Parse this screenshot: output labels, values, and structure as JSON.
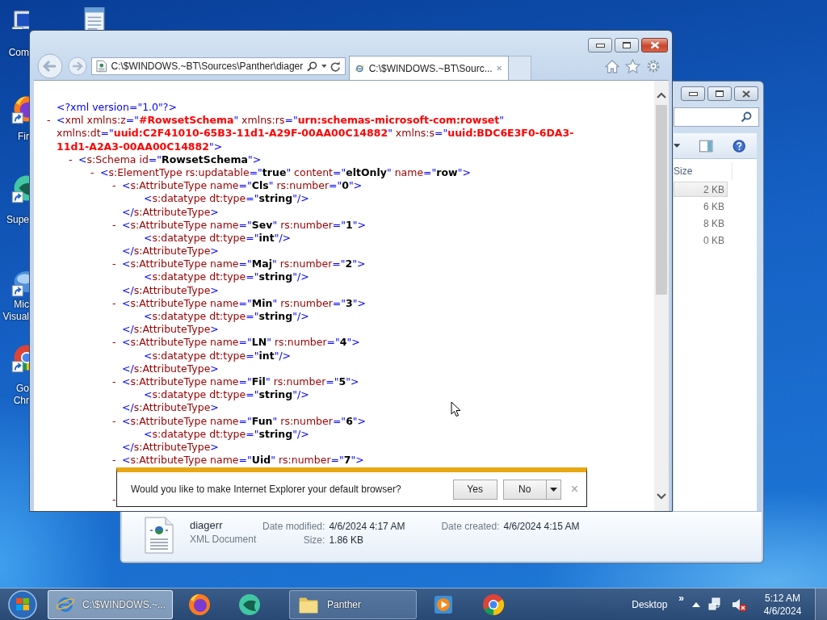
{
  "desktop_icons": [
    {
      "kind": "computer",
      "label": [
        "Com"
      ]
    },
    {
      "kind": "notepad"
    },
    {
      "kind": "firefox",
      "label": [
        "Fir"
      ]
    },
    {
      "kind": "app",
      "label": [
        "Supe"
      ]
    },
    {
      "kind": "vs",
      "label": [
        "Mic",
        "Visual"
      ]
    },
    {
      "kind": "chrome",
      "label": [
        "Go",
        "Chr"
      ]
    }
  ],
  "explorer": {
    "columns": [
      "Size"
    ],
    "rows": [
      {
        "size": "2 KB",
        "selected": true
      },
      {
        "size": "6 KB",
        "selected": false
      },
      {
        "size": "8 KB",
        "selected": false
      },
      {
        "size": "0 KB",
        "selected": false
      }
    ],
    "details": {
      "name": "diagerr",
      "type": "XML Document",
      "fields": [
        {
          "label": "Date modified:",
          "value": "4/6/2024 4:17 AM"
        },
        {
          "label": "Size:",
          "value": "1.86 KB"
        },
        {
          "label": "Date created:",
          "value": "4/6/2024 4:15 AM"
        }
      ]
    }
  },
  "browser": {
    "address": "C:\\$WINDOWS.~BT\\Sources\\Panther\\diager",
    "tabs": [
      {
        "title": "C:\\$WINDOWS.~BT\\Sourc...",
        "selected": true
      }
    ],
    "document": [
      {
        "open": [
          [
            {
              "kind": "p",
              "text": "<?xml version=\"1.0\"?>"
            }
          ]
        ]
      },
      {
        "marker": "-",
        "open": [
          [
            {
              "kind": "p",
              "text": "<"
            },
            {
              "kind": "n",
              "text": "xml"
            },
            {
              "kind": "n",
              "text": " xmlns:z"
            },
            {
              "kind": "p",
              "text": "=\""
            },
            {
              "kind": "r",
              "text": "#RowsetSchema"
            },
            {
              "kind": "p",
              "text": "\""
            },
            {
              "kind": "n",
              "text": " xmlns:rs"
            },
            {
              "kind": "p",
              "text": "=\""
            },
            {
              "kind": "r",
              "text": "urn:schemas-microsoft-com:rowset"
            },
            {
              "kind": "p",
              "text": "\""
            }
          ],
          [
            {
              "kind": "n",
              "text": "xmlns:dt"
            },
            {
              "kind": "p",
              "text": "=\""
            },
            {
              "kind": "r",
              "text": "uuid:C2F41010-65B3-11d1-A29F-00AA00C14882"
            },
            {
              "kind": "p",
              "text": "\""
            },
            {
              "kind": "n",
              "text": " xmlns:s"
            },
            {
              "kind": "p",
              "text": "=\""
            },
            {
              "kind": "r",
              "text": "uuid:BDC6E3F0-6DA3-"
            }
          ],
          [
            {
              "kind": "r",
              "text": "11d1-A2A3-00AA00C14882"
            },
            {
              "kind": "p",
              "text": "\">"
            }
          ]
        ],
        "children": [
          {
            "marker": "-",
            "open": [
              [
                {
                  "kind": "p",
                  "text": "<"
                },
                {
                  "kind": "n",
                  "text": "s:Schema"
                },
                {
                  "kind": "n",
                  "text": " id"
                },
                {
                  "kind": "p",
                  "text": "=\""
                },
                {
                  "kind": "v",
                  "text": "RowsetSchema"
                },
                {
                  "kind": "p",
                  "text": "\">"
                }
              ]
            ],
            "children": [
              {
                "marker": "-",
                "open": [
                  [
                    {
                      "kind": "p",
                      "text": "<"
                    },
                    {
                      "kind": "n",
                      "text": "s:ElementType"
                    },
                    {
                      "kind": "n",
                      "text": " rs:updatable"
                    },
                    {
                      "kind": "p",
                      "text": "=\""
                    },
                    {
                      "kind": "v",
                      "text": "true"
                    },
                    {
                      "kind": "p",
                      "text": "\""
                    },
                    {
                      "kind": "n",
                      "text": " content"
                    },
                    {
                      "kind": "p",
                      "text": "=\""
                    },
                    {
                      "kind": "v",
                      "text": "eltOnly"
                    },
                    {
                      "kind": "p",
                      "text": "\""
                    },
                    {
                      "kind": "n",
                      "text": " name"
                    },
                    {
                      "kind": "p",
                      "text": "=\""
                    },
                    {
                      "kind": "v",
                      "text": "row"
                    },
                    {
                      "kind": "p",
                      "text": "\">"
                    }
                  ]
                ],
                "children": [
                  {
                    "marker": "-",
                    "open": [
                      [
                        {
                          "kind": "p",
                          "text": "<"
                        },
                        {
                          "kind": "n",
                          "text": "s:AttributeType"
                        },
                        {
                          "kind": "n",
                          "text": " name"
                        },
                        {
                          "kind": "p",
                          "text": "=\""
                        },
                        {
                          "kind": "v",
                          "text": "Cls"
                        },
                        {
                          "kind": "p",
                          "text": "\""
                        },
                        {
                          "kind": "n",
                          "text": " rs:number"
                        },
                        {
                          "kind": "p",
                          "text": "=\""
                        },
                        {
                          "kind": "v",
                          "text": "0"
                        },
                        {
                          "kind": "p",
                          "text": "\">"
                        }
                      ]
                    ],
                    "children": [
                      {
                        "open": [
                          [
                            {
                              "kind": "p",
                              "text": "<"
                            },
                            {
                              "kind": "n",
                              "text": "s:datatype"
                            },
                            {
                              "kind": "n",
                              "text": " dt:type"
                            },
                            {
                              "kind": "p",
                              "text": "=\""
                            },
                            {
                              "kind": "v",
                              "text": "string"
                            },
                            {
                              "kind": "p",
                              "text": "\"/>"
                            }
                          ]
                        ]
                      }
                    ],
                    "close": [
                      {
                        "kind": "p",
                        "text": "</"
                      },
                      {
                        "kind": "n",
                        "text": "s:AttributeType"
                      },
                      {
                        "kind": "p",
                        "text": ">"
                      }
                    ]
                  },
                  {
                    "marker": "-",
                    "open": [
                      [
                        {
                          "kind": "p",
                          "text": "<"
                        },
                        {
                          "kind": "n",
                          "text": "s:AttributeType"
                        },
                        {
                          "kind": "n",
                          "text": " name"
                        },
                        {
                          "kind": "p",
                          "text": "=\""
                        },
                        {
                          "kind": "v",
                          "text": "Sev"
                        },
                        {
                          "kind": "p",
                          "text": "\""
                        },
                        {
                          "kind": "n",
                          "text": " rs:number"
                        },
                        {
                          "kind": "p",
                          "text": "=\""
                        },
                        {
                          "kind": "v",
                          "text": "1"
                        },
                        {
                          "kind": "p",
                          "text": "\">"
                        }
                      ]
                    ],
                    "children": [
                      {
                        "open": [
                          [
                            {
                              "kind": "p",
                              "text": "<"
                            },
                            {
                              "kind": "n",
                              "text": "s:datatype"
                            },
                            {
                              "kind": "n",
                              "text": " dt:type"
                            },
                            {
                              "kind": "p",
                              "text": "=\""
                            },
                            {
                              "kind": "v",
                              "text": "int"
                            },
                            {
                              "kind": "p",
                              "text": "\"/>"
                            }
                          ]
                        ]
                      }
                    ],
                    "close": [
                      {
                        "kind": "p",
                        "text": "</"
                      },
                      {
                        "kind": "n",
                        "text": "s:AttributeType"
                      },
                      {
                        "kind": "p",
                        "text": ">"
                      }
                    ]
                  },
                  {
                    "marker": "-",
                    "open": [
                      [
                        {
                          "kind": "p",
                          "text": "<"
                        },
                        {
                          "kind": "n",
                          "text": "s:AttributeType"
                        },
                        {
                          "kind": "n",
                          "text": " name"
                        },
                        {
                          "kind": "p",
                          "text": "=\""
                        },
                        {
                          "kind": "v",
                          "text": "Maj"
                        },
                        {
                          "kind": "p",
                          "text": "\""
                        },
                        {
                          "kind": "n",
                          "text": " rs:number"
                        },
                        {
                          "kind": "p",
                          "text": "=\""
                        },
                        {
                          "kind": "v",
                          "text": "2"
                        },
                        {
                          "kind": "p",
                          "text": "\">"
                        }
                      ]
                    ],
                    "children": [
                      {
                        "open": [
                          [
                            {
                              "kind": "p",
                              "text": "<"
                            },
                            {
                              "kind": "n",
                              "text": "s:datatype"
                            },
                            {
                              "kind": "n",
                              "text": " dt:type"
                            },
                            {
                              "kind": "p",
                              "text": "=\""
                            },
                            {
                              "kind": "v",
                              "text": "string"
                            },
                            {
                              "kind": "p",
                              "text": "\"/>"
                            }
                          ]
                        ]
                      }
                    ],
                    "close": [
                      {
                        "kind": "p",
                        "text": "</"
                      },
                      {
                        "kind": "n",
                        "text": "s:AttributeType"
                      },
                      {
                        "kind": "p",
                        "text": ">"
                      }
                    ]
                  },
                  {
                    "marker": "-",
                    "open": [
                      [
                        {
                          "kind": "p",
                          "text": "<"
                        },
                        {
                          "kind": "n",
                          "text": "s:AttributeType"
                        },
                        {
                          "kind": "n",
                          "text": " name"
                        },
                        {
                          "kind": "p",
                          "text": "=\""
                        },
                        {
                          "kind": "v",
                          "text": "Min"
                        },
                        {
                          "kind": "p",
                          "text": "\""
                        },
                        {
                          "kind": "n",
                          "text": " rs:number"
                        },
                        {
                          "kind": "p",
                          "text": "=\""
                        },
                        {
                          "kind": "v",
                          "text": "3"
                        },
                        {
                          "kind": "p",
                          "text": "\">"
                        }
                      ]
                    ],
                    "children": [
                      {
                        "open": [
                          [
                            {
                              "kind": "p",
                              "text": "<"
                            },
                            {
                              "kind": "n",
                              "text": "s:datatype"
                            },
                            {
                              "kind": "n",
                              "text": " dt:type"
                            },
                            {
                              "kind": "p",
                              "text": "=\""
                            },
                            {
                              "kind": "v",
                              "text": "string"
                            },
                            {
                              "kind": "p",
                              "text": "\"/>"
                            }
                          ]
                        ]
                      }
                    ],
                    "close": [
                      {
                        "kind": "p",
                        "text": "</"
                      },
                      {
                        "kind": "n",
                        "text": "s:AttributeType"
                      },
                      {
                        "kind": "p",
                        "text": ">"
                      }
                    ]
                  },
                  {
                    "marker": "-",
                    "open": [
                      [
                        {
                          "kind": "p",
                          "text": "<"
                        },
                        {
                          "kind": "n",
                          "text": "s:AttributeType"
                        },
                        {
                          "kind": "n",
                          "text": " name"
                        },
                        {
                          "kind": "p",
                          "text": "=\""
                        },
                        {
                          "kind": "v",
                          "text": "LN"
                        },
                        {
                          "kind": "p",
                          "text": "\""
                        },
                        {
                          "kind": "n",
                          "text": " rs:number"
                        },
                        {
                          "kind": "p",
                          "text": "=\""
                        },
                        {
                          "kind": "v",
                          "text": "4"
                        },
                        {
                          "kind": "p",
                          "text": "\">"
                        }
                      ]
                    ],
                    "children": [
                      {
                        "open": [
                          [
                            {
                              "kind": "p",
                              "text": "<"
                            },
                            {
                              "kind": "n",
                              "text": "s:datatype"
                            },
                            {
                              "kind": "n",
                              "text": " dt:type"
                            },
                            {
                              "kind": "p",
                              "text": "=\""
                            },
                            {
                              "kind": "v",
                              "text": "int"
                            },
                            {
                              "kind": "p",
                              "text": "\"/>"
                            }
                          ]
                        ]
                      }
                    ],
                    "close": [
                      {
                        "kind": "p",
                        "text": "</"
                      },
                      {
                        "kind": "n",
                        "text": "s:AttributeType"
                      },
                      {
                        "kind": "p",
                        "text": ">"
                      }
                    ]
                  },
                  {
                    "marker": "-",
                    "open": [
                      [
                        {
                          "kind": "p",
                          "text": "<"
                        },
                        {
                          "kind": "n",
                          "text": "s:AttributeType"
                        },
                        {
                          "kind": "n",
                          "text": " name"
                        },
                        {
                          "kind": "p",
                          "text": "=\""
                        },
                        {
                          "kind": "v",
                          "text": "Fil"
                        },
                        {
                          "kind": "p",
                          "text": "\""
                        },
                        {
                          "kind": "n",
                          "text": " rs:number"
                        },
                        {
                          "kind": "p",
                          "text": "=\""
                        },
                        {
                          "kind": "v",
                          "text": "5"
                        },
                        {
                          "kind": "p",
                          "text": "\">"
                        }
                      ]
                    ],
                    "children": [
                      {
                        "open": [
                          [
                            {
                              "kind": "p",
                              "text": "<"
                            },
                            {
                              "kind": "n",
                              "text": "s:datatype"
                            },
                            {
                              "kind": "n",
                              "text": " dt:type"
                            },
                            {
                              "kind": "p",
                              "text": "=\""
                            },
                            {
                              "kind": "v",
                              "text": "string"
                            },
                            {
                              "kind": "p",
                              "text": "\"/>"
                            }
                          ]
                        ]
                      }
                    ],
                    "close": [
                      {
                        "kind": "p",
                        "text": "</"
                      },
                      {
                        "kind": "n",
                        "text": "s:AttributeType"
                      },
                      {
                        "kind": "p",
                        "text": ">"
                      }
                    ]
                  },
                  {
                    "marker": "-",
                    "open": [
                      [
                        {
                          "kind": "p",
                          "text": "<"
                        },
                        {
                          "kind": "n",
                          "text": "s:AttributeType"
                        },
                        {
                          "kind": "n",
                          "text": " name"
                        },
                        {
                          "kind": "p",
                          "text": "=\""
                        },
                        {
                          "kind": "v",
                          "text": "Fun"
                        },
                        {
                          "kind": "p",
                          "text": "\""
                        },
                        {
                          "kind": "n",
                          "text": " rs:number"
                        },
                        {
                          "kind": "p",
                          "text": "=\""
                        },
                        {
                          "kind": "v",
                          "text": "6"
                        },
                        {
                          "kind": "p",
                          "text": "\">"
                        }
                      ]
                    ],
                    "children": [
                      {
                        "open": [
                          [
                            {
                              "kind": "p",
                              "text": "<"
                            },
                            {
                              "kind": "n",
                              "text": "s:datatype"
                            },
                            {
                              "kind": "n",
                              "text": " dt:type"
                            },
                            {
                              "kind": "p",
                              "text": "=\""
                            },
                            {
                              "kind": "v",
                              "text": "string"
                            },
                            {
                              "kind": "p",
                              "text": "\"/>"
                            }
                          ]
                        ]
                      }
                    ],
                    "close": [
                      {
                        "kind": "p",
                        "text": "</"
                      },
                      {
                        "kind": "n",
                        "text": "s:AttributeType"
                      },
                      {
                        "kind": "p",
                        "text": ">"
                      }
                    ]
                  },
                  {
                    "marker": "-",
                    "open": [
                      [
                        {
                          "kind": "p",
                          "text": "<"
                        },
                        {
                          "kind": "n",
                          "text": "s:AttributeType"
                        },
                        {
                          "kind": "n",
                          "text": " name"
                        },
                        {
                          "kind": "p",
                          "text": "=\""
                        },
                        {
                          "kind": "v",
                          "text": "Uid"
                        },
                        {
                          "kind": "p",
                          "text": "\""
                        },
                        {
                          "kind": "n",
                          "text": " rs:number"
                        },
                        {
                          "kind": "p",
                          "text": "=\""
                        },
                        {
                          "kind": "v",
                          "text": "7"
                        },
                        {
                          "kind": "p",
                          "text": "\">"
                        }
                      ]
                    ]
                  },
                  {
                    "marker": "-"
                  }
                ]
              }
            ]
          }
        ]
      }
    ],
    "notification": {
      "message": "Would you like to make Internet Explorer your default browser?",
      "buttons": [
        "Yes",
        "No"
      ],
      "close": "×"
    }
  },
  "taskbar": {
    "items": [
      {
        "kind": "ie",
        "label": "C:\\$WINDOWS.~...",
        "selected": true
      },
      {
        "kind": "firefox",
        "selected": false
      },
      {
        "kind": "app",
        "selected": false
      },
      {
        "kind": "folder",
        "label": "Panther",
        "selected": false
      },
      {
        "kind": "media",
        "selected": false
      },
      {
        "kind": "chrome",
        "selected": false
      }
    ],
    "toolbar": "Desktop",
    "overflow": "»",
    "clock": {
      "time": "5:12 AM",
      "date": "4/6/2024"
    }
  }
}
